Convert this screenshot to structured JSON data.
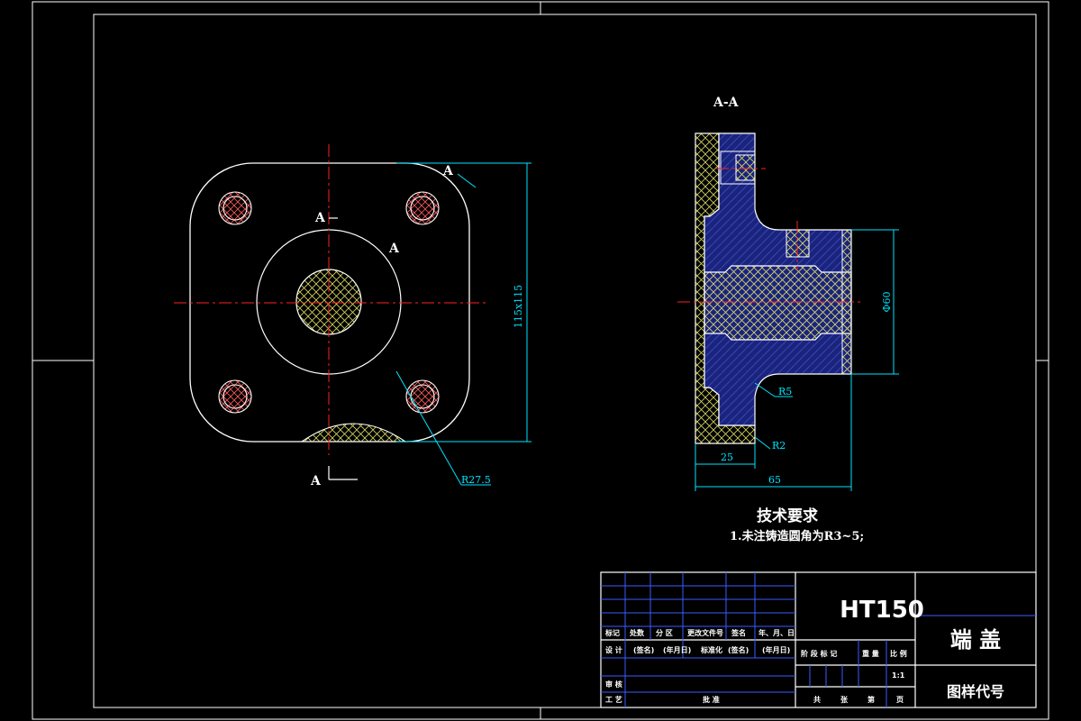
{
  "views": {
    "section_title": "A-A",
    "cut_label_top": "A",
    "cut_label_bottom": "A",
    "cut_label_arc_top": "A",
    "cut_label_arc_mid": "A"
  },
  "dimensions": {
    "front_size": "115x115",
    "fillet_radius": "R27.5",
    "section_diameter": "Φ60",
    "fillet_r5": "R5",
    "fillet_r2": "R2",
    "width_25": "25",
    "width_65": "65"
  },
  "notes": {
    "heading": "技术要求",
    "item1": "1.未注铸造圆角为R3~5;"
  },
  "title_block": {
    "material": "HT150",
    "part_name": "端 盖",
    "drawing_code": "图样代号",
    "row1": [
      "标记",
      "处数",
      "分 区",
      "更改文件号",
      "签名",
      "年、月、日"
    ],
    "row2": [
      "设 计",
      "(签名)",
      "(年月日)",
      "标准化",
      "(签名)",
      "(年月日)"
    ],
    "reviewer": "审 核",
    "process": "工 艺",
    "approve": "批 准",
    "stage_headers": [
      "阶 段 标 记",
      "重 量",
      "比 例"
    ],
    "scale": "1:1",
    "sheet_total": "共",
    "sheet_word": "张",
    "sheet_no": "第",
    "page_word": "页"
  }
}
